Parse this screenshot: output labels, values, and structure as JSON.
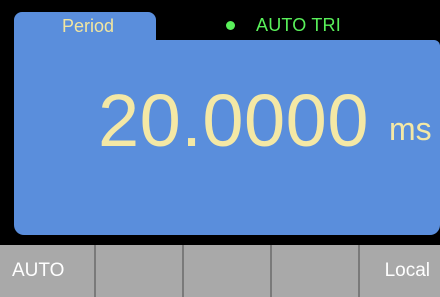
{
  "display": {
    "function_tab": "Period",
    "trigger_status": "AUTO TRI",
    "reading": "20.0000",
    "unit": "ms"
  },
  "colors": {
    "panel": "#5a8edc",
    "reading_text": "#f4e8a5",
    "trigger_indicator": "#59f05a",
    "softkey_background": "#a9a9a9"
  },
  "softkeys": [
    {
      "label": "AUTO"
    },
    {
      "label": ""
    },
    {
      "label": ""
    },
    {
      "label": ""
    },
    {
      "label": "Local"
    }
  ]
}
